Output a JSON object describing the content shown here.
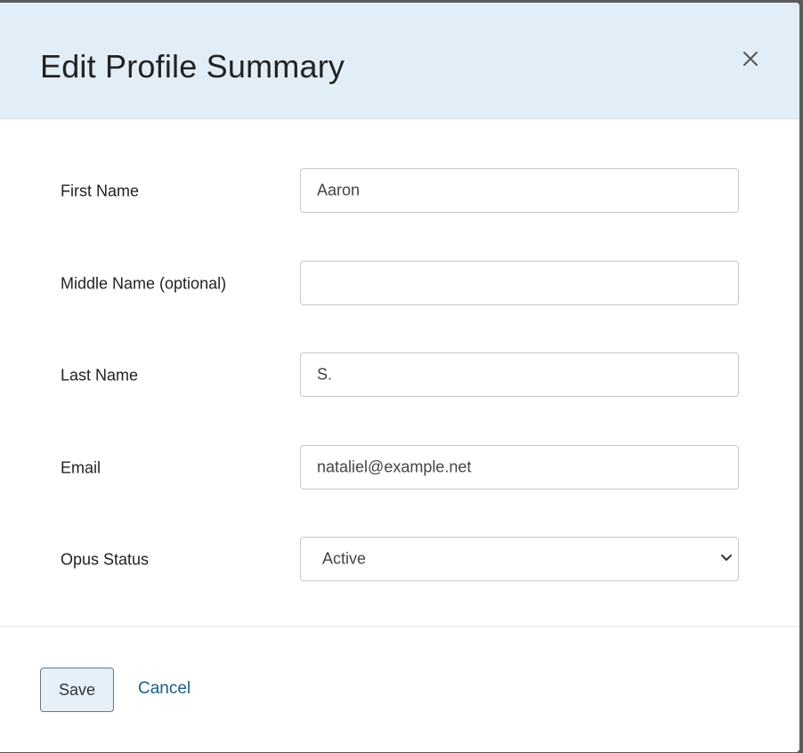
{
  "dialog": {
    "title": "Edit Profile Summary",
    "close_icon": "close-icon"
  },
  "form": {
    "first_name": {
      "label": "First Name",
      "value": "Aaron"
    },
    "middle_name": {
      "label": "Middle Name (optional)",
      "value": ""
    },
    "last_name": {
      "label": "Last Name",
      "value": "S."
    },
    "email": {
      "label": "Email",
      "value": "nataliel@example.net"
    },
    "opus_status": {
      "label": "Opus Status",
      "selected": "Active",
      "icon": "chevron-down-icon"
    }
  },
  "footer": {
    "save_label": "Save",
    "cancel_label": "Cancel"
  },
  "colors": {
    "header_bg": "#e2eef7",
    "link": "#1a5e8a",
    "save_bg": "#e6f0f8"
  }
}
